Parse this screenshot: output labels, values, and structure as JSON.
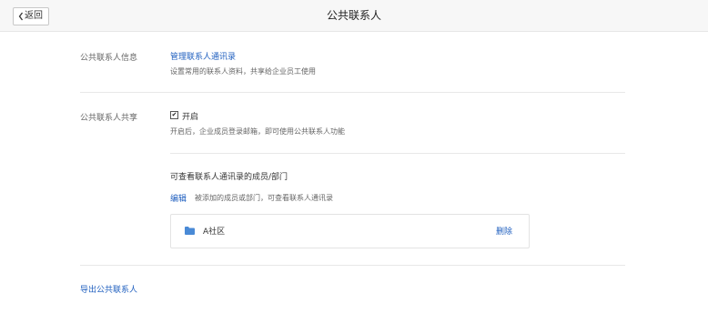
{
  "header": {
    "back_label": "返回",
    "title": "公共联系人"
  },
  "contact_info": {
    "label": "公共联系人信息",
    "manage_link": "管理联系人通讯录",
    "hint": "设置常用的联系人资料，共享给企业员工使用"
  },
  "contact_share": {
    "label": "公共联系人共享",
    "enabled": true,
    "enable_label": "开启",
    "hint": "开启后，企业成员登录邮箱，即可使用公共联系人功能"
  },
  "visibility": {
    "heading": "可查看联系人通讯录的成员/部门",
    "edit_link": "编辑",
    "hint": "被添加的成员或部门，可查看联系人通讯录",
    "items": [
      {
        "name": "A社区",
        "delete_label": "删除"
      }
    ]
  },
  "export": {
    "link": "导出公共联系人"
  },
  "colors": {
    "link": "#1f5fbf",
    "folder": "#4a8ad6",
    "topbar_bg": "#f7f7f7"
  }
}
